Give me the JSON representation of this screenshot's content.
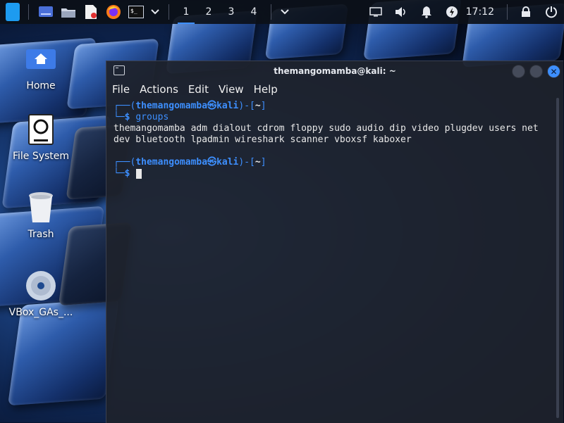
{
  "panel": {
    "workspaces": [
      "1",
      "2",
      "3",
      "4"
    ],
    "active_workspace": "1",
    "clock": "17:12",
    "icons": [
      "kali-menu-icon",
      "show-desktop-icon",
      "file-manager-icon",
      "text-editor-icon",
      "firefox-icon",
      "terminal-icon",
      "chevron-down-icon",
      "screen-icon",
      "volume-icon",
      "bell-icon",
      "power-manager-icon",
      "lock-icon",
      "logout-icon"
    ]
  },
  "desktop": {
    "items": [
      {
        "label": "Home",
        "icon": "home-folder-icon"
      },
      {
        "label": "File System",
        "icon": "drive-icon"
      },
      {
        "label": "Trash",
        "icon": "trash-icon"
      },
      {
        "label": "VBox_GAs_...",
        "icon": "disc-icon"
      }
    ]
  },
  "terminal": {
    "title": "themangomamba@kali: ~",
    "menu": [
      "File",
      "Actions",
      "Edit",
      "View",
      "Help"
    ],
    "prompt_user": "themangomamba",
    "prompt_host": "kali",
    "prompt_dir": "~",
    "command": "groups",
    "output_line1": "themangomamba adm dialout cdrom floppy sudo audio dip video plugdev users net",
    "output_line2": "dev bluetooth lpadmin wireshark scanner vboxsf kaboxer"
  },
  "colors": {
    "accent": "#3d8fff",
    "panel_bg": "#0c1018",
    "terminal_bg": "#1e222c"
  }
}
